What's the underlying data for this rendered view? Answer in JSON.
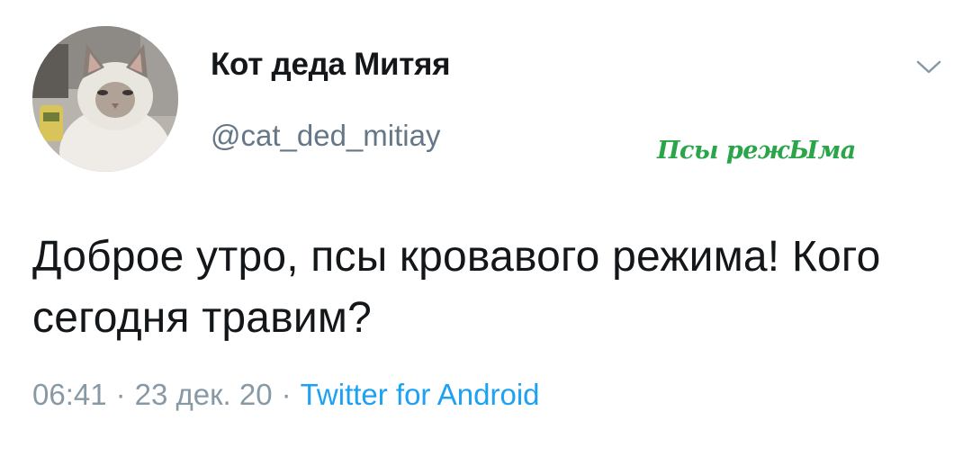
{
  "author": {
    "display_name": "Кот деда Митяя",
    "handle": "@cat_ded_mitiay"
  },
  "tweet": {
    "text": "Доброе утро, псы кровавого режима! Кого сегодня травим?",
    "time": "06:41",
    "date": "23 дек. 20",
    "separator": "·",
    "source": "Twitter for Android"
  },
  "watermark": {
    "text": "Псы режЫма"
  },
  "icons": {
    "menu_caret": "chevron-down-icon",
    "avatar": "cat-photo"
  },
  "colors": {
    "handle": "#657786",
    "meta": "#8899a6",
    "link": "#1da1f2",
    "watermark": "#2aa54a"
  }
}
